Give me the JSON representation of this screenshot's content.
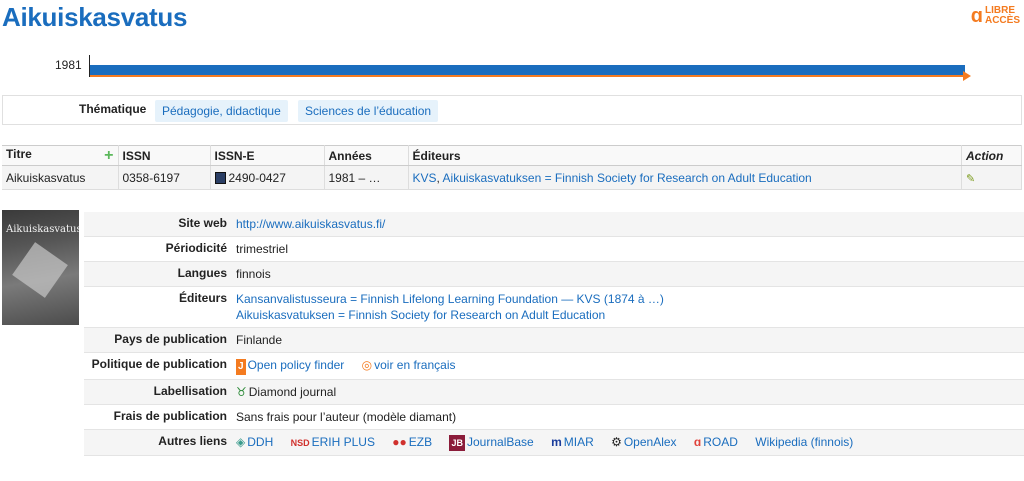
{
  "page": {
    "title": "Aikuiskasvatus"
  },
  "badge": {
    "icon": "open-access-icon",
    "text_line1": "LIBRE",
    "text_line2": "ACCÈS"
  },
  "timeline": {
    "start_year": "1981",
    "colors": {
      "bar": "#1a6dbe",
      "line": "#f47b20"
    }
  },
  "thematique": {
    "label": "Thématique",
    "tags": [
      "Pédagogie, didactique",
      "Sciences de l’éducation"
    ]
  },
  "table": {
    "headers": [
      "Titre",
      "ISSN",
      "ISSN-E",
      "Années",
      "Éditeurs",
      "Action"
    ],
    "row": {
      "titre": "Aikuiskasvatus",
      "issn": "0358-6197",
      "issn_e": "2490-0427",
      "annees": "1981 – …",
      "editeur_1": "KVS",
      "sep": ", ",
      "editeur_2": "Aikuiskasvatuksen = Finnish Society for Research on Adult Education"
    }
  },
  "cover": {
    "title": "Aikuiskasvatus"
  },
  "details": {
    "site_web": {
      "label": "Site web",
      "value": "http://www.aikuiskasvatus.fi/"
    },
    "periodicite": {
      "label": "Périodicité",
      "value": "trimestriel"
    },
    "langues": {
      "label": "Langues",
      "value": "finnois"
    },
    "editeurs": {
      "label": "Éditeurs",
      "line1": "Kansanvalistusseura = Finnish Lifelong Learning Foundation — KVS (1874 à …)",
      "line2": "Aikuiskasvatuksen = Finnish Society for Research on Adult Education"
    },
    "pays": {
      "label": "Pays de publication",
      "value": "Finlande"
    },
    "politique": {
      "label": "Politique de publication",
      "link1": "Open policy finder",
      "link2": "voir en français"
    },
    "labellisation": {
      "label": "Labellisation",
      "value": "Diamond journal"
    },
    "frais": {
      "label": "Frais de publication",
      "value": "Sans frais pour l’auteur (modèle diamant)"
    },
    "autres_liens": {
      "label": "Autres liens",
      "links": [
        "DDH",
        "ERIH PLUS",
        "EZB",
        "JournalBase",
        "MIAR",
        "OpenAlex",
        "ROAD",
        "Wikipedia (finnois)"
      ]
    }
  }
}
